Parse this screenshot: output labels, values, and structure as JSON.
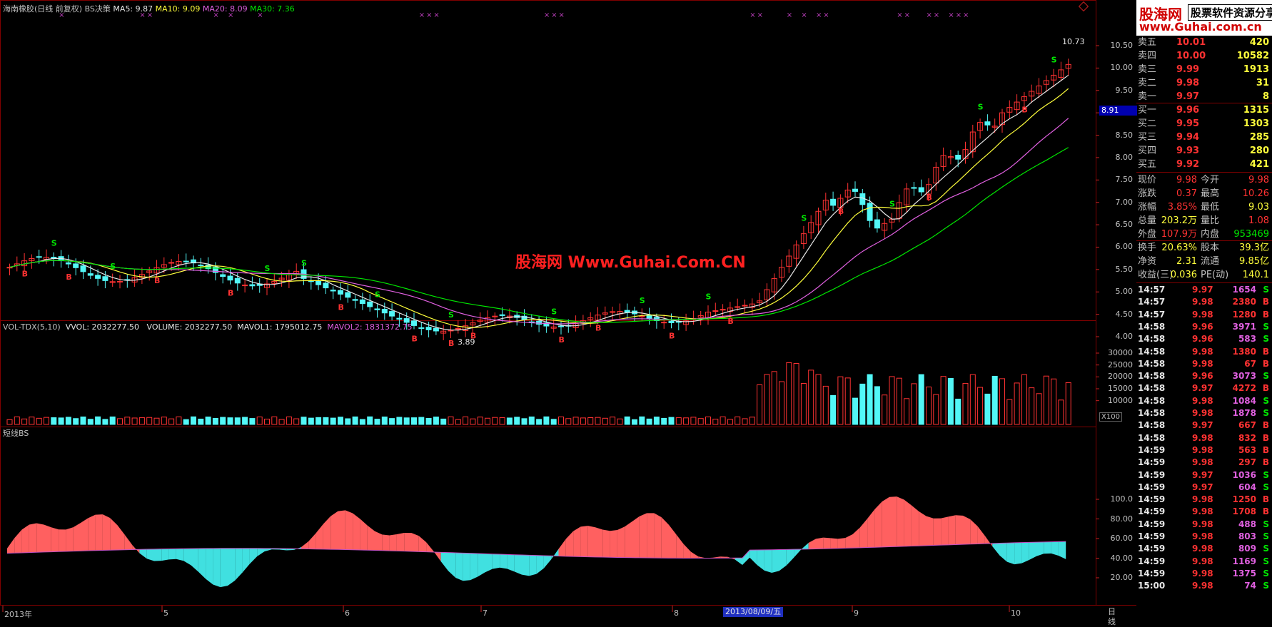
{
  "header": {
    "stock_title": "海南橡胶(日线 前复权) BS决策",
    "ma_labels": [
      {
        "text": "MA5: 9.87",
        "color": "#e6e6e6"
      },
      {
        "text": "MA10: 9.09",
        "color": "#ffff3c"
      },
      {
        "text": "MA20: 8.09",
        "color": "#e060e0"
      },
      {
        "text": "MA30: 7.36",
        "color": "#00e600"
      }
    ]
  },
  "price_axis": [
    "10.50",
    "10.00",
    "9.50",
    "9.00",
    "8.50",
    "8.00",
    "7.50",
    "7.00",
    "6.50",
    "6.00",
    "5.50",
    "5.00",
    "4.50",
    "4.00"
  ],
  "current_price_tag": "8.91",
  "high_label": "10.73",
  "low_label": "3.89",
  "signals": {
    "sell": "S",
    "buy": "B",
    "top_marker": "×"
  },
  "volume_header": {
    "name": "VOL-TDX(5,10)",
    "vvol": "VVOL: 2032277.50",
    "volume": "VOLUME: 2032277.50",
    "mavol1": "MAVOL1: 1795012.75",
    "mavol2": "MAVOL2: 1831372.75"
  },
  "volume_axis": [
    "30000",
    "25000",
    "20000",
    "15000",
    "10000"
  ],
  "volume_unit": "X100",
  "indicator_title": "短线BS",
  "indicator_axis": [
    "100.0",
    "80.00",
    "60.00",
    "40.00",
    "20.00"
  ],
  "x_axis": {
    "dates": [
      "2013年",
      "5",
      "6",
      "7",
      "8",
      "9",
      "10"
    ],
    "cursor_date": "2013/08/09/五",
    "period": "日线"
  },
  "watermark": "股海网 Www.Guhai.Com.CN",
  "brand": {
    "logo": "股海网",
    "slogan": "股票软件资源分享",
    "url": "www.Guhai.com.cn"
  },
  "order_book": [
    {
      "label": "卖五",
      "price": "10.01",
      "vol": "420",
      "pc": "#ff3232"
    },
    {
      "label": "卖四",
      "price": "10.00",
      "vol": "10582",
      "pc": "#ff3232"
    },
    {
      "label": "卖三",
      "price": "9.99",
      "vol": "1913",
      "pc": "#ff3232"
    },
    {
      "label": "卖二",
      "price": "9.98",
      "vol": "31",
      "pc": "#ff3232"
    },
    {
      "label": "卖一",
      "price": "9.97",
      "vol": "8",
      "pc": "#ff3232"
    },
    {
      "label": "买一",
      "price": "9.96",
      "vol": "1315",
      "pc": "#ff3232"
    },
    {
      "label": "买二",
      "price": "9.95",
      "vol": "1303",
      "pc": "#ff3232"
    },
    {
      "label": "买三",
      "price": "9.94",
      "vol": "285",
      "pc": "#ff3232"
    },
    {
      "label": "买四",
      "price": "9.93",
      "vol": "280",
      "pc": "#ff3232"
    },
    {
      "label": "买五",
      "price": "9.92",
      "vol": "421",
      "pc": "#ff3232"
    }
  ],
  "quote": [
    {
      "l1": "现价",
      "v1": "9.98",
      "c1": "#ff3232",
      "l2": "今开",
      "v2": "9.98",
      "c2": "#ff3232"
    },
    {
      "l1": "涨跌",
      "v1": "0.37",
      "c1": "#ff3232",
      "l2": "最高",
      "v2": "10.26",
      "c2": "#ff3232"
    },
    {
      "l1": "涨幅",
      "v1": "3.85%",
      "c1": "#ff3232",
      "l2": "最低",
      "v2": "9.03",
      "c2": "#ffff3c"
    },
    {
      "l1": "总量",
      "v1": "203.2万",
      "c1": "#ffff3c",
      "l2": "量比",
      "v2": "1.08",
      "c2": "#ff3232"
    },
    {
      "l1": "外盘",
      "v1": "107.9万",
      "c1": "#ff3232",
      "l2": "内盘",
      "v2": "953469",
      "c2": "#00e600"
    },
    {
      "l1": "换手",
      "v1": "20.63%",
      "c1": "#ffff3c",
      "l2": "股本",
      "v2": "39.3亿",
      "c2": "#ffff3c"
    },
    {
      "l1": "净资",
      "v1": "2.31",
      "c1": "#ffff3c",
      "l2": "流通",
      "v2": "9.85亿",
      "c2": "#ffff3c"
    },
    {
      "l1": "收益(三)",
      "v1": "0.036",
      "c1": "#ffff3c",
      "l2": "PE(动)",
      "v2": "140.1",
      "c2": "#ffff3c"
    }
  ],
  "ticks": [
    {
      "t": "14:57",
      "p": "9.97",
      "v": "1654",
      "d": "S"
    },
    {
      "t": "14:57",
      "p": "9.98",
      "v": "2380",
      "d": "B"
    },
    {
      "t": "14:57",
      "p": "9.98",
      "v": "1280",
      "d": "B"
    },
    {
      "t": "14:58",
      "p": "9.96",
      "v": "3971",
      "d": "S"
    },
    {
      "t": "14:58",
      "p": "9.96",
      "v": "583",
      "d": "S"
    },
    {
      "t": "14:58",
      "p": "9.98",
      "v": "1380",
      "d": "B"
    },
    {
      "t": "14:58",
      "p": "9.98",
      "v": "67",
      "d": "B"
    },
    {
      "t": "14:58",
      "p": "9.96",
      "v": "3073",
      "d": "S"
    },
    {
      "t": "14:58",
      "p": "9.97",
      "v": "4272",
      "d": "B"
    },
    {
      "t": "14:58",
      "p": "9.98",
      "v": "1084",
      "d": "S"
    },
    {
      "t": "14:58",
      "p": "9.98",
      "v": "1878",
      "d": "S"
    },
    {
      "t": "14:58",
      "p": "9.97",
      "v": "667",
      "d": "B"
    },
    {
      "t": "14:58",
      "p": "9.98",
      "v": "832",
      "d": "B"
    },
    {
      "t": "14:59",
      "p": "9.98",
      "v": "563",
      "d": "B"
    },
    {
      "t": "14:59",
      "p": "9.98",
      "v": "297",
      "d": "B"
    },
    {
      "t": "14:59",
      "p": "9.97",
      "v": "1036",
      "d": "S"
    },
    {
      "t": "14:59",
      "p": "9.97",
      "v": "604",
      "d": "S"
    },
    {
      "t": "14:59",
      "p": "9.98",
      "v": "1250",
      "d": "B"
    },
    {
      "t": "14:59",
      "p": "9.98",
      "v": "1708",
      "d": "B"
    },
    {
      "t": "14:59",
      "p": "9.98",
      "v": "488",
      "d": "S"
    },
    {
      "t": "14:59",
      "p": "9.98",
      "v": "803",
      "d": "S"
    },
    {
      "t": "14:59",
      "p": "9.98",
      "v": "809",
      "d": "S"
    },
    {
      "t": "14:59",
      "p": "9.98",
      "v": "1169",
      "d": "S"
    },
    {
      "t": "14:59",
      "p": "9.98",
      "v": "1375",
      "d": "S"
    },
    {
      "t": "15:00",
      "p": "9.98",
      "v": "74",
      "d": "S"
    }
  ],
  "colors": {
    "up": "#ff3232",
    "down": "#52f7f7",
    "ma5": "#e6e6e6",
    "ma10": "#ffff3c",
    "ma20": "#e060e0",
    "ma30": "#00e600",
    "panel_border": "#800000",
    "ind_pos": "#ff6060",
    "ind_neg": "#40e0e0"
  }
}
